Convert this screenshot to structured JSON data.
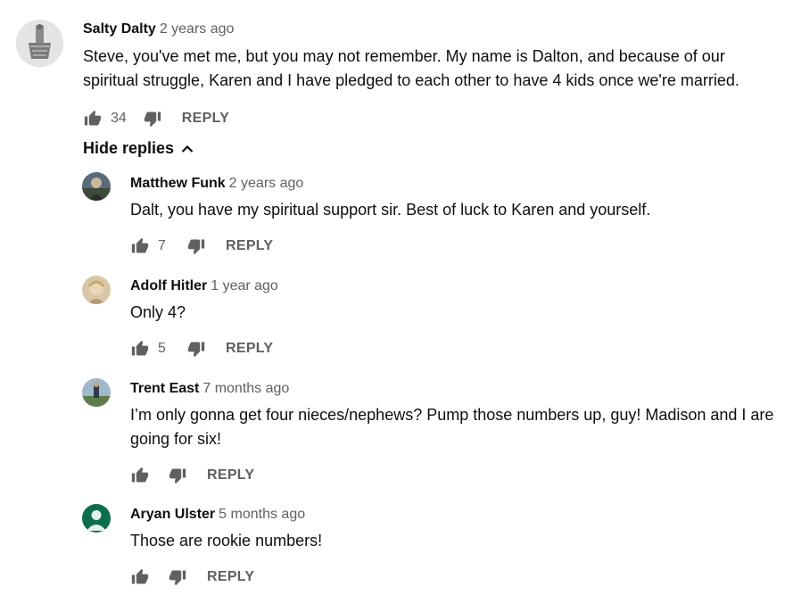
{
  "main_comment": {
    "author": "Salty Dalty",
    "time": "2 years ago",
    "text": "Steve, you've met me, but you may not remember. My name is Dalton, and because of our spiritual struggle, Karen and I have pledged to each other to have 4 kids once we're married.",
    "likes": "34",
    "reply_label": "REPLY"
  },
  "hide_replies_label": "Hide replies",
  "replies": [
    {
      "author": "Matthew Funk",
      "time": "2 years ago",
      "text": "Dalt, you have my spiritual support sir.  Best of luck to Karen and yourself.",
      "likes": "7",
      "reply_label": "REPLY"
    },
    {
      "author": "Adolf Hitler",
      "time": "1 year ago",
      "text": "Only 4?",
      "likes": "5",
      "reply_label": "REPLY"
    },
    {
      "author": "Trent East",
      "time": "7 months ago",
      "text": "I’m only gonna get four nieces/nephews? Pump those numbers up, guy! Madison and I are going for six!",
      "likes": "",
      "reply_label": "REPLY"
    },
    {
      "author": "Aryan Ulster",
      "time": "5 months ago",
      "text": "Those are rookie numbers!",
      "likes": "",
      "reply_label": "REPLY"
    }
  ],
  "icons": {
    "like": "thumb-up-icon",
    "dislike": "thumb-down-icon",
    "hide": "chevron-up-icon"
  },
  "colors": {
    "text": "#0f0f0f",
    "secondary": "#606060",
    "icon": "#606060",
    "default_avatar": "#0b6e4f"
  }
}
